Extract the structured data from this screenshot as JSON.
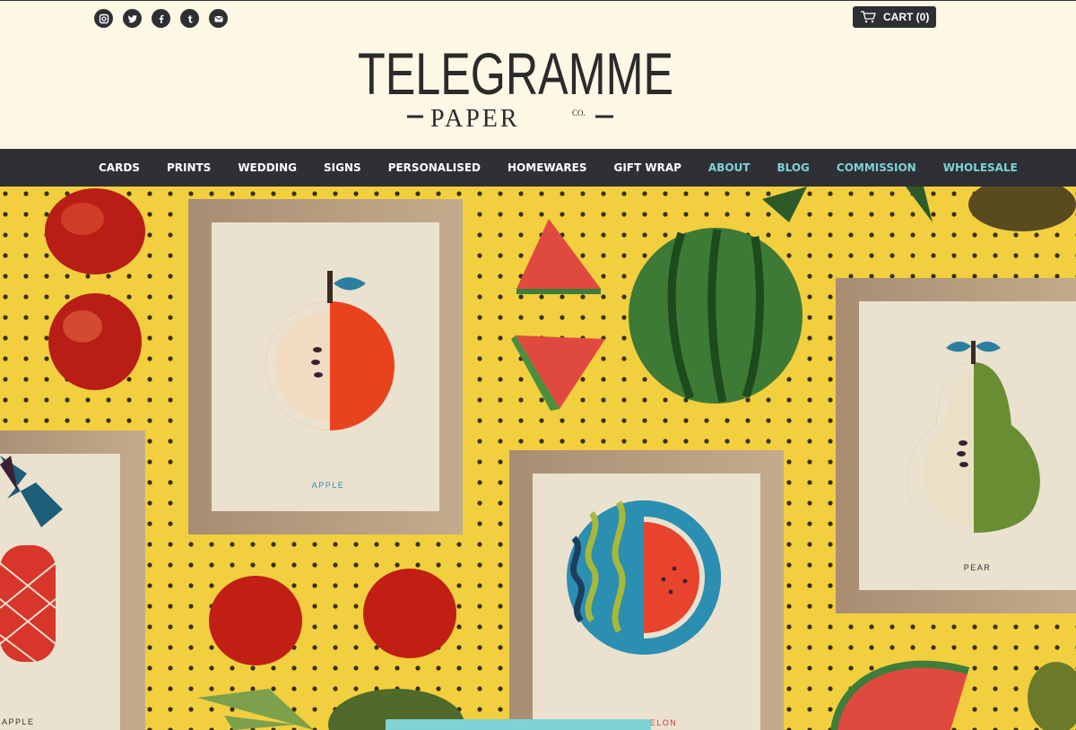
{
  "brand": {
    "name_main": "TELEGRAMME",
    "name_sub": "PAPER",
    "name_co": "CO."
  },
  "social_icons": [
    "instagram-icon",
    "twitter-icon",
    "facebook-icon",
    "tumblr-icon",
    "email-icon"
  ],
  "cart": {
    "label": "CART (0)"
  },
  "nav": {
    "items": [
      {
        "label": "CARDS",
        "accent": false
      },
      {
        "label": "PRINTS",
        "accent": false
      },
      {
        "label": "WEDDING",
        "accent": false
      },
      {
        "label": "SIGNS",
        "accent": false
      },
      {
        "label": "PERSONALISED",
        "accent": false
      },
      {
        "label": "HOMEWARES",
        "accent": false
      },
      {
        "label": "GIFT WRAP",
        "accent": false
      },
      {
        "label": "ABOUT",
        "accent": true
      },
      {
        "label": "BLOG",
        "accent": true
      },
      {
        "label": "COMMISSION",
        "accent": true
      },
      {
        "label": "WHOLESALE",
        "accent": true
      }
    ]
  },
  "hero": {
    "prints": {
      "apple": "APPLE",
      "pear": "PEAR",
      "watermelon": "WATERMELON",
      "pineapple": "APPLE"
    }
  },
  "colors": {
    "cream": "#fdf7e6",
    "dark": "#2e3035",
    "accent": "#7fd2d6",
    "pegboard": "#f1cf3f"
  }
}
